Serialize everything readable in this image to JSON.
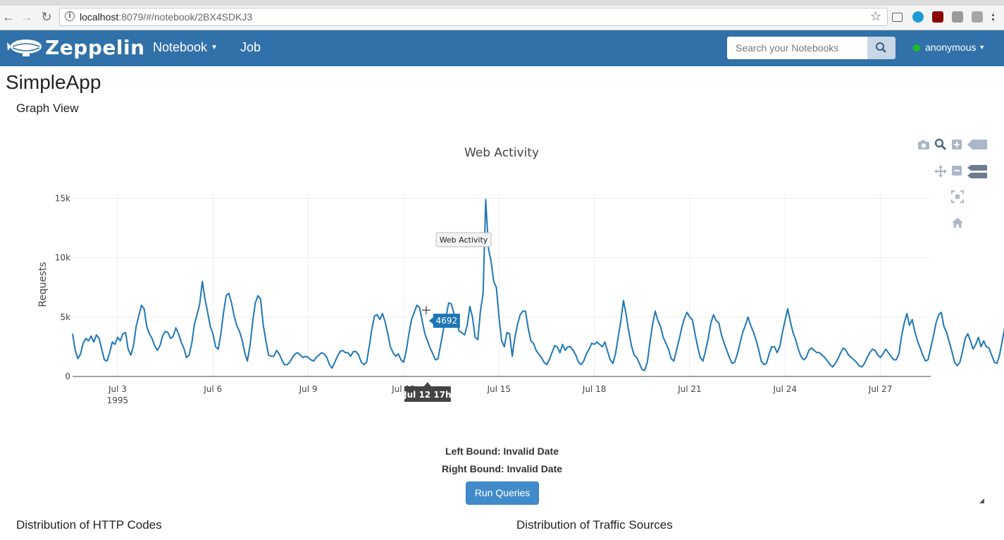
{
  "browser": {
    "url_host": "localhost",
    "url_path": ":8079/#/notebook/2BX4SDKJ3"
  },
  "navbar": {
    "brand": "Zeppelin",
    "notebook_label": "Notebook",
    "job_label": "Job",
    "search_placeholder": "Search your Notebooks",
    "user_label": "anonymous",
    "colors": {
      "bar": "#3071a9",
      "status": "#1ec01e"
    }
  },
  "notebook": {
    "title": "SimpleApp",
    "paragraph_title": "Graph View"
  },
  "chart_data": {
    "type": "line",
    "title": "Web Activity",
    "ylabel": "Requests",
    "xlabel": "",
    "x_start": "1995-07-01T14:00",
    "x_end": "1995-07-28T14:00",
    "step_hours": 2,
    "ylim": [
      0,
      15500
    ],
    "yticks": [
      {
        "value": 0,
        "label": "0"
      },
      {
        "value": 5000,
        "label": "5k"
      },
      {
        "value": 10000,
        "label": "10k"
      },
      {
        "value": 15000,
        "label": "15k"
      }
    ],
    "xticks": [
      {
        "date": "1995-07-03",
        "label": "Jul 3",
        "sub": "1995"
      },
      {
        "date": "1995-07-06",
        "label": "Jul 6"
      },
      {
        "date": "1995-07-09",
        "label": "Jul 9"
      },
      {
        "date": "1995-07-12",
        "label": "Jul 12"
      },
      {
        "date": "1995-07-15",
        "label": "Jul 15"
      },
      {
        "date": "1995-07-18",
        "label": "Jul 18"
      },
      {
        "date": "1995-07-21",
        "label": "Jul 21"
      },
      {
        "date": "1995-07-24",
        "label": "Jul 24"
      },
      {
        "date": "1995-07-27",
        "label": "Jul 27"
      }
    ],
    "series": [
      {
        "name": "Web Activity",
        "color": "#1f77b4",
        "values": [
          3600,
          2200,
          1500,
          1900,
          2800,
          3200,
          3000,
          3400,
          2900,
          3500,
          3200,
          2300,
          1400,
          1300,
          2000,
          2900,
          2700,
          3300,
          3000,
          3600,
          3700,
          2300,
          1800,
          2600,
          4200,
          5100,
          6000,
          5700,
          4200,
          3600,
          3200,
          2600,
          2200,
          2600,
          3400,
          3800,
          3700,
          3200,
          3400,
          4100,
          3600,
          2900,
          2400,
          1600,
          1800,
          2800,
          4400,
          5200,
          6100,
          8000,
          6500,
          5400,
          4200,
          3600,
          2500,
          2300,
          3600,
          5400,
          6800,
          7000,
          6200,
          5100,
          4300,
          3800,
          3100,
          2000,
          1300,
          2600,
          4600,
          6200,
          6800,
          6500,
          4300,
          3000,
          1800,
          1700,
          1700,
          2200,
          1900,
          1400,
          1000,
          1000,
          1200,
          1600,
          1900,
          2000,
          1800,
          1600,
          1700,
          1600,
          1400,
          1300,
          1600,
          1800,
          2000,
          1900,
          1600,
          1000,
          700,
          1200,
          1700,
          2100,
          2200,
          2000,
          2000,
          1700,
          2100,
          2100,
          1800,
          1200,
          1000,
          1200,
          2500,
          4000,
          5100,
          5200,
          4800,
          5300,
          4600,
          3600,
          2500,
          2000,
          1700,
          1900,
          1400,
          1200,
          2200,
          3600,
          4800,
          5400,
          6000,
          5800,
          4700,
          3600,
          3000,
          2400,
          1900,
          1400,
          1500,
          2700,
          3900,
          5000,
          6200,
          6100,
          5300,
          4500,
          3800,
          3700,
          3500,
          4300,
          5900,
          5000,
          3300,
          3100,
          5500,
          7000,
          14900,
          10800,
          9700,
          8000,
          7500,
          5000,
          3000,
          2500,
          3700,
          3600,
          1700,
          3300,
          4400,
          5200,
          5500,
          5500,
          4100,
          3000,
          2800,
          2200,
          1900,
          1600,
          1200,
          1000,
          1400,
          2000,
          2600,
          2500,
          2000,
          2700,
          2200,
          2500,
          2500,
          2200,
          1800,
          1200,
          1000,
          1300,
          1900,
          2300,
          2800,
          2700,
          2900,
          2700,
          2500,
          2900,
          2100,
          1400,
          1100,
          1900,
          3300,
          4700,
          6400,
          5200,
          3800,
          2600,
          1800,
          1600,
          1100,
          600,
          500,
          1200,
          2900,
          4400,
          5500,
          4700,
          4200,
          3300,
          2800,
          2300,
          1500,
          1300,
          2200,
          3100,
          4100,
          4900,
          5400,
          5000,
          4800,
          3600,
          2500,
          1600,
          1300,
          2200,
          3200,
          4500,
          5200,
          4700,
          4500,
          3500,
          2800,
          2200,
          1600,
          1100,
          1200,
          1900,
          2800,
          3700,
          4300,
          5000,
          4300,
          3800,
          3100,
          2300,
          1300,
          1000,
          1100,
          1900,
          2500,
          2500,
          2000,
          2500,
          3700,
          4700,
          5700,
          4600,
          3700,
          3100,
          2300,
          1700,
          1400,
          1600,
          2200,
          2400,
          2200,
          2000,
          2000,
          1800,
          1600,
          1300,
          1000,
          800,
          1100,
          1500,
          2000,
          2400,
          2200,
          1800,
          1600,
          1400,
          1200,
          900,
          800,
          1100,
          1600,
          2000,
          2300,
          2200,
          1800,
          1600,
          1900,
          2300,
          2000,
          1700,
          1400,
          1400,
          1900,
          3400,
          4500,
          5300,
          4300,
          4800,
          3800,
          3000,
          2400,
          1800,
          1300,
          1400,
          2400,
          3400,
          4500,
          5200,
          5400,
          4200,
          3700,
          2900,
          2100,
          1200,
          900,
          1200,
          2100,
          3200,
          3600,
          3000,
          2300,
          2700,
          3300,
          2500,
          3000,
          2500,
          2400,
          1800,
          1200,
          1100,
          1800,
          3000,
          4200,
          4800,
          4300,
          3900,
          3200,
          2600,
          2000,
          1600,
          1100,
          1800,
          2100,
          2200,
          2100,
          2200,
          2100,
          2200,
          2400,
          3300,
          4200,
          4800,
          4600,
          3800,
          3300,
          2800,
          2100,
          1400,
          1000,
          900,
          2000,
          2900,
          3600,
          3500,
          3300,
          2400,
          2000
        ]
      }
    ],
    "hover": {
      "value_label": "4692",
      "x_label": "Jul 12 17h",
      "trace_label": "Web Activity"
    }
  },
  "bounds": {
    "left": "Left Bound: Invalid Date",
    "right": "Right Bound: Invalid Date"
  },
  "run_button_label": "Run Queries",
  "subsections": {
    "http_codes": "Distribution of HTTP Codes",
    "traffic_sources": "Distribution of Traffic Sources"
  }
}
